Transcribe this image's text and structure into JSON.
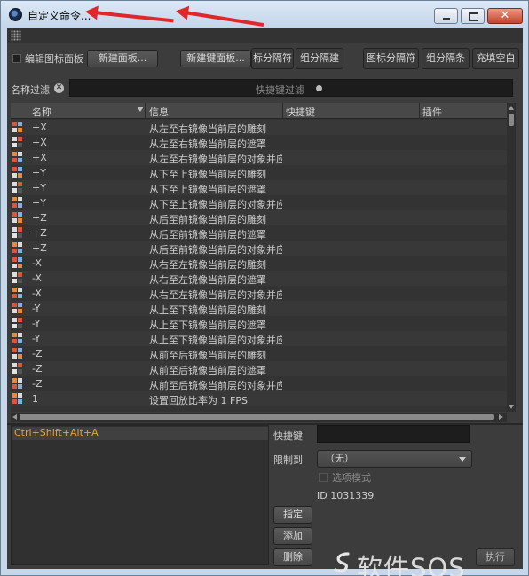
{
  "window": {
    "title": "自定义命令...",
    "close_symbol": "✕"
  },
  "toolbar": {
    "edit_palette_label": "编辑图标面板",
    "new_palette_button": "新建面板...",
    "new_shortcut_palette_button": "新建键面板...",
    "tab_separator_button": "标分隔符",
    "group_separator_button": "组分隔建",
    "icon_separator_button": "图标分隔符",
    "group_divider_button": "组分隔条",
    "fill_blank_button": "充填空白"
  },
  "filter": {
    "label": "名称过滤",
    "clear_symbol": "✕",
    "ghost_text": "快捷键过滤"
  },
  "table": {
    "columns": [
      "名称",
      "信息",
      "快捷键",
      "插件"
    ],
    "rows": [
      {
        "name": "+X",
        "info": "从左至右镜像当前层的雕刻",
        "ico": "sculpt"
      },
      {
        "name": "+X",
        "info": "从左至右镜像当前层的遮罩",
        "ico": "mask"
      },
      {
        "name": "+X",
        "info": "从左至右镜像当前层的对象并应",
        "ico": "obj"
      },
      {
        "name": "+Y",
        "info": "从下至上镜像当前层的雕刻",
        "ico": "sculpt"
      },
      {
        "name": "+Y",
        "info": "从下至上镜像当前层的遮罩",
        "ico": "mask"
      },
      {
        "name": "+Y",
        "info": "从下至上镜像当前层的对象并应",
        "ico": "obj"
      },
      {
        "name": "+Z",
        "info": "从后至前镜像当前层的雕刻",
        "ico": "sculpt"
      },
      {
        "name": "+Z",
        "info": "从后至前镜像当前层的遮罩",
        "ico": "mask"
      },
      {
        "name": "+Z",
        "info": "从后至前镜像当前层的对象并应",
        "ico": "obj"
      },
      {
        "name": "-X",
        "info": "从右至左镜像当前层的雕刻",
        "ico": "sculpt"
      },
      {
        "name": "-X",
        "info": "从右至左镜像当前层的遮罩",
        "ico": "mask"
      },
      {
        "name": "-X",
        "info": "从右至左镜像当前层的对象并应",
        "ico": "obj"
      },
      {
        "name": "-Y",
        "info": "从上至下镜像当前层的雕刻",
        "ico": "sculpt"
      },
      {
        "name": "-Y",
        "info": "从上至下镜像当前层的遮罩",
        "ico": "mask"
      },
      {
        "name": "-Y",
        "info": "从上至下镜像当前层的对象并应",
        "ico": "obj"
      },
      {
        "name": "-Z",
        "info": "从前至后镜像当前层的雕刻",
        "ico": "sculpt"
      },
      {
        "name": "-Z",
        "info": "从前至后镜像当前层的遮罩",
        "ico": "mask"
      },
      {
        "name": "-Z",
        "info": "从前至后镜像当前层的对象并应",
        "ico": "obj"
      },
      {
        "name": "1",
        "info": "设置回放比率为 1 FPS",
        "ico": "obj"
      }
    ]
  },
  "details": {
    "shortcut_entry": "Ctrl+Shift+Alt+A",
    "shortcut_label": "快捷键",
    "restrict_label": "限制到",
    "restrict_value": "（无）",
    "option_mode_label": "选项模式",
    "id_text": "ID 1031339",
    "assign_button": "指定",
    "add_button": "添加",
    "delete_button": "删除",
    "execute_button": "执行"
  },
  "watermark": "软件SOS",
  "colors": {
    "shortcut_text": "#e8a33a",
    "arrow": "#e0272a"
  }
}
